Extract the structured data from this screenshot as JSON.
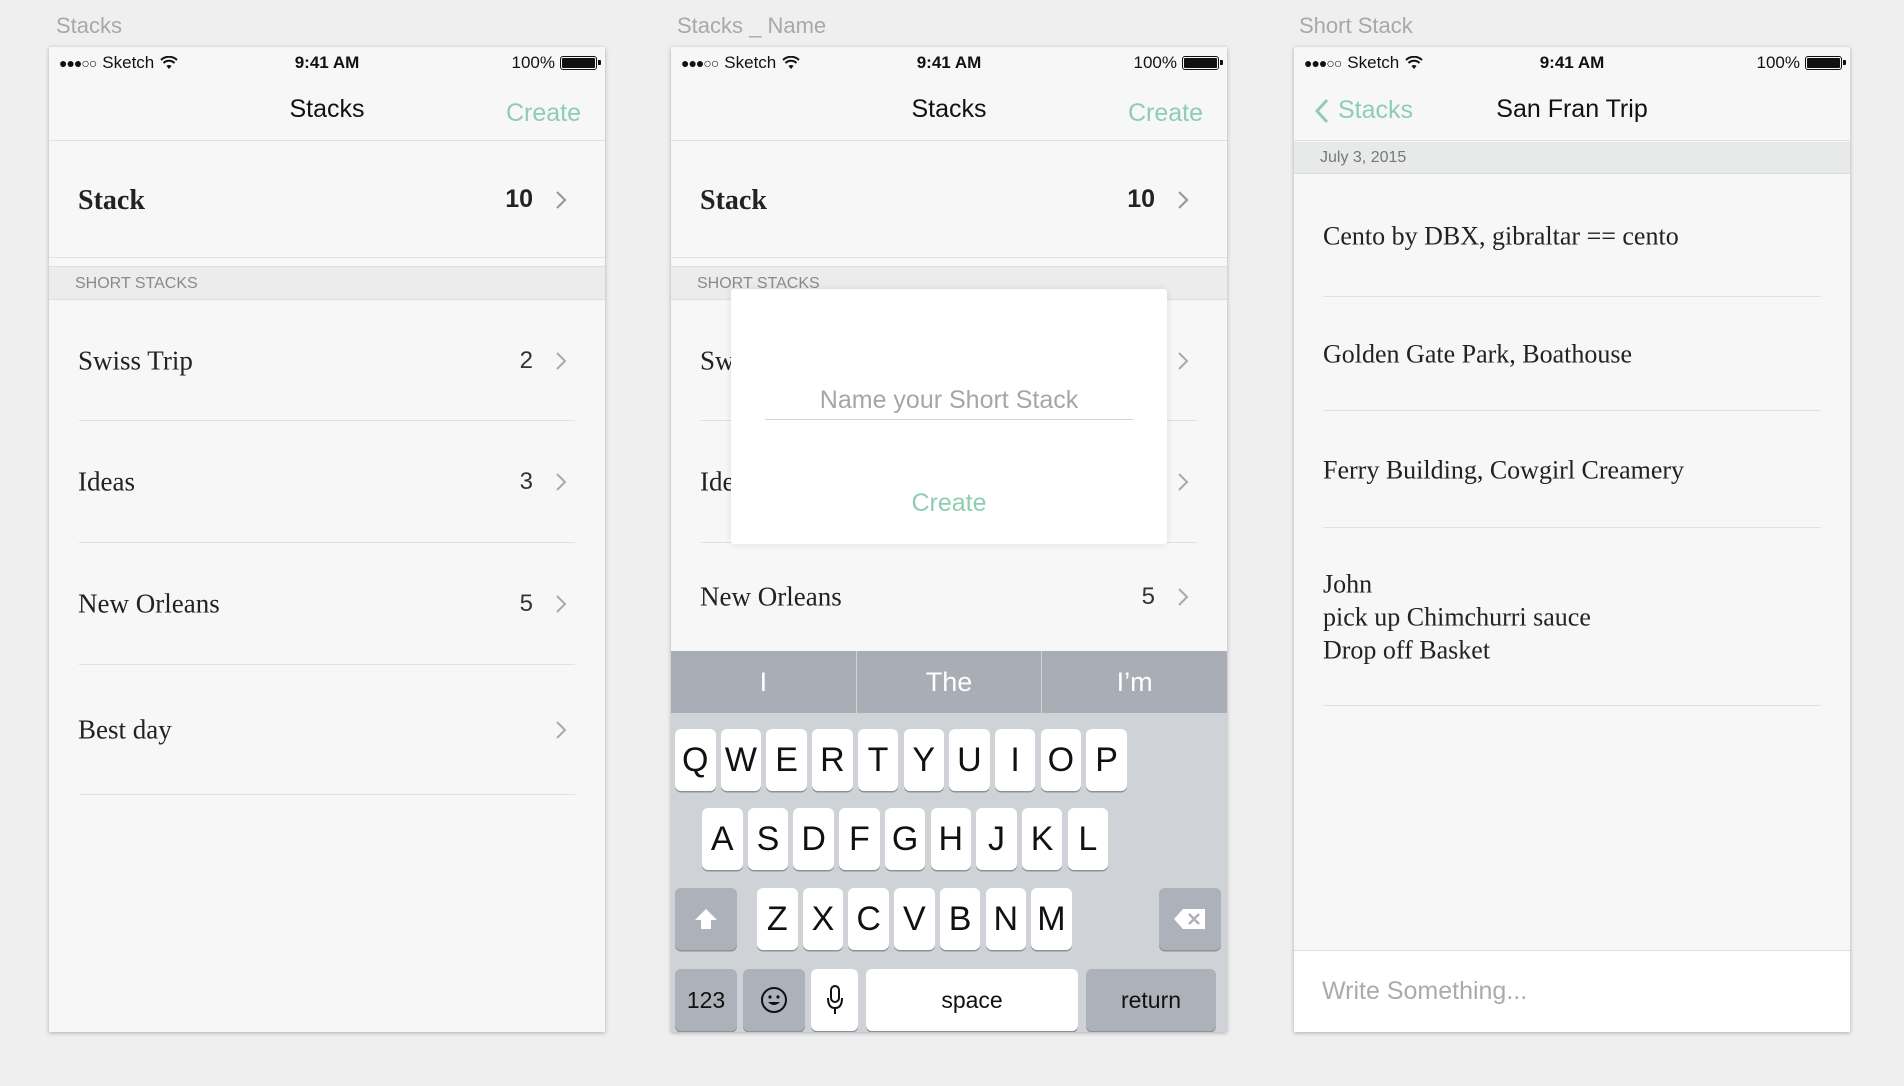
{
  "artboards": [
    "Stacks",
    "Stacks _ Name",
    "Short Stack"
  ],
  "status": {
    "signal": "●●●○○",
    "carrier": "Sketch",
    "time": "9:41 AM",
    "battery": "100%"
  },
  "colors": {
    "accent": "#8fcdb3",
    "background": "#efefef",
    "keyboard": "#cfd2d7",
    "suggestion_bar": "#a9aeb6"
  },
  "screen1": {
    "title": "Stacks",
    "create": "Create",
    "main_stack": {
      "name": "Stack",
      "count": "10"
    },
    "section": "SHORT STACKS",
    "items": [
      {
        "name": "Swiss Trip",
        "count": "2"
      },
      {
        "name": "Ideas",
        "count": "3"
      },
      {
        "name": "New Orleans",
        "count": "5"
      },
      {
        "name": "Best day",
        "count": ""
      }
    ]
  },
  "screen2": {
    "title": "Stacks",
    "create": "Create",
    "main_stack": {
      "name": "Stack",
      "count": "10"
    },
    "section": "SHORT STACKS",
    "items": [
      {
        "name": "Sw",
        "count": ""
      },
      {
        "name": "Ide",
        "count": ""
      },
      {
        "name": "New Orleans",
        "count": "5"
      }
    ],
    "modal": {
      "placeholder": "Name your Short Stack",
      "create": "Create"
    },
    "keyboard": {
      "suggestions": [
        "I",
        "The",
        "I’m"
      ],
      "row1": [
        "Q",
        "W",
        "E",
        "R",
        "T",
        "Y",
        "U",
        "I",
        "O",
        "P"
      ],
      "row2": [
        "A",
        "S",
        "D",
        "F",
        "G",
        "H",
        "J",
        "K",
        "L"
      ],
      "row3": [
        "Z",
        "X",
        "C",
        "V",
        "B",
        "N",
        "M"
      ],
      "numbers": "123",
      "space": "space",
      "return": "return"
    }
  },
  "screen3": {
    "back": "Stacks",
    "title": "San Fran Trip",
    "date": "July 3, 2015",
    "notes": [
      "Cento by DBX, gibraltar == cento",
      "Golden Gate Park, Boathouse",
      "Ferry Building, Cowgirl Creamery",
      "John\npick up Chimchurri sauce\nDrop off Basket"
    ],
    "composer_placeholder": "Write Something..."
  }
}
